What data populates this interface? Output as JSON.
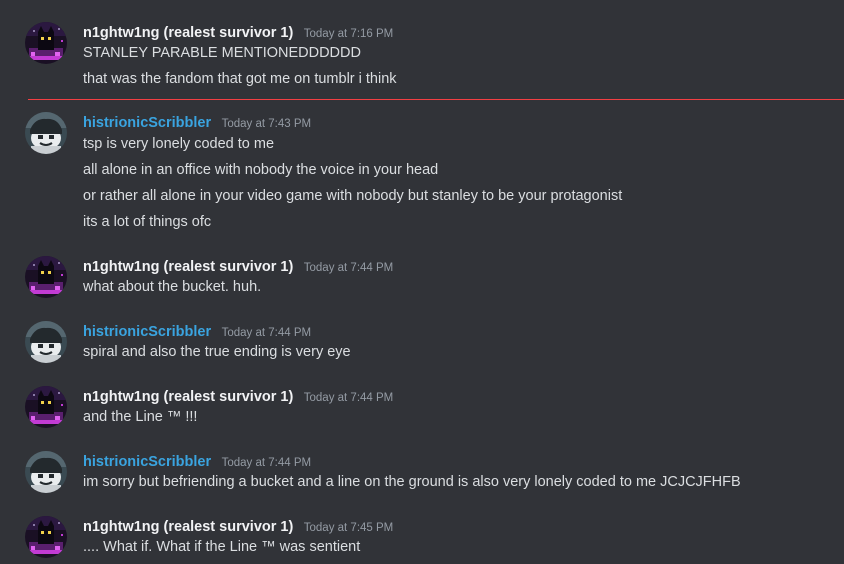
{
  "colors": {
    "background": "#313338",
    "text": "#dbdee1",
    "timestamp": "#949ba4",
    "user_nightwing": "#f2f3f5",
    "user_histrionic": "#3aa4e0",
    "new_messages_divider": "#f23f43"
  },
  "messages": [
    {
      "author": "n1ghtw1ng (realest survivor 1)",
      "avatar_icon": "purple-pixel-cat-avatar",
      "timestamp": "Today at 7:16 PM",
      "lines": [
        "STANLEY PARABLE MENTIONEDDDDDD",
        "that was the fandom that got me on tumblr i think"
      ]
    },
    {
      "author": "histrionicScribbler",
      "avatar_icon": "monochrome-face-avatar",
      "timestamp": "Today at 7:43 PM",
      "lines": [
        "tsp is very lonely coded to me",
        "all alone in an office with nobody the voice in your head",
        "or rather all alone in your video game with nobody but stanley to be your protagonist",
        "its a lot of things ofc"
      ]
    },
    {
      "author": "n1ghtw1ng (realest survivor 1)",
      "avatar_icon": "purple-pixel-cat-avatar",
      "timestamp": "Today at 7:44 PM",
      "lines": [
        "what about the bucket. huh."
      ]
    },
    {
      "author": "histrionicScribbler",
      "avatar_icon": "monochrome-face-avatar",
      "timestamp": "Today at 7:44 PM",
      "lines": [
        "spiral and also the true ending is very eye"
      ]
    },
    {
      "author": "n1ghtw1ng (realest survivor 1)",
      "avatar_icon": "purple-pixel-cat-avatar",
      "timestamp": "Today at 7:44 PM",
      "lines": [
        "and the Line ™ !!!"
      ]
    },
    {
      "author": "histrionicScribbler",
      "avatar_icon": "monochrome-face-avatar",
      "timestamp": "Today at 7:44 PM",
      "lines": [
        "im sorry but befriending a bucket and a line on the ground is also very lonely coded to me JCJCJFHFB"
      ]
    },
    {
      "author": "n1ghtw1ng (realest survivor 1)",
      "avatar_icon": "purple-pixel-cat-avatar",
      "timestamp": "Today at 7:45 PM",
      "lines": [
        ".... What if. What if the Line ™ was sentient"
      ]
    }
  ]
}
